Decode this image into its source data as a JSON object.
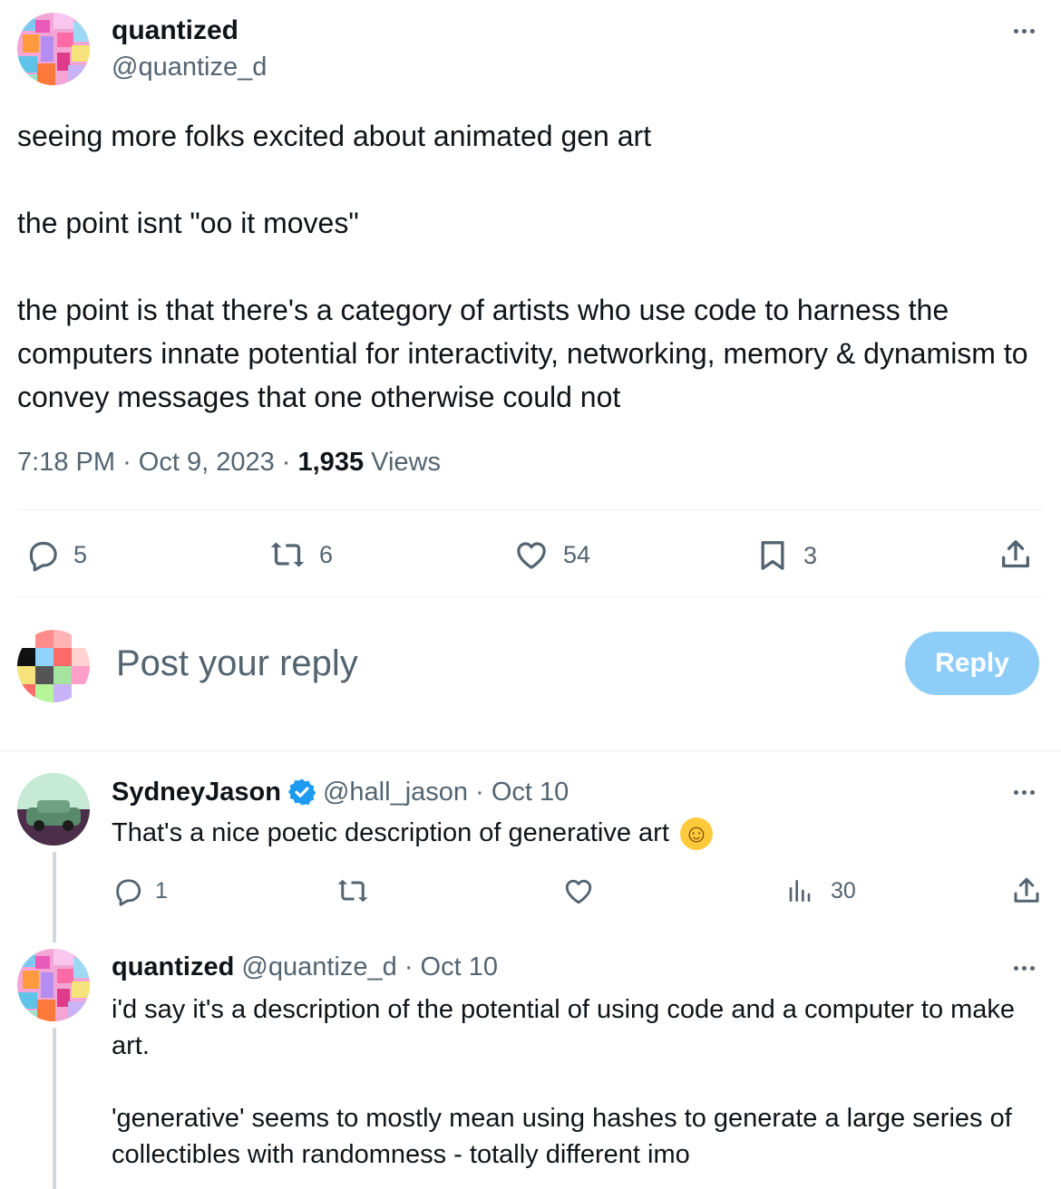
{
  "main_tweet": {
    "display_name": "quantized",
    "handle": "@quantize_d",
    "paragraphs": [
      "seeing more folks excited about animated gen art",
      "the point isnt \"oo it moves\"",
      "the point is that there's a category of artists who use code to harness the computers innate potential for interactivity, networking, memory & dynamism to convey messages that one otherwise could not"
    ],
    "time": "7:18 PM",
    "date": "Oct 9, 2023",
    "views_count": "1,935",
    "views_label": "Views",
    "replies": "5",
    "reposts": "6",
    "likes": "54",
    "bookmarks": "3"
  },
  "composer": {
    "placeholder": "Post your reply",
    "reply_label": "Reply"
  },
  "replies": [
    {
      "display_name": "SydneyJason",
      "handle": "@hall_jason",
      "date": "Oct 10",
      "text": "That's a nice poetic description of generative art",
      "emoji": "☺",
      "replies": "1",
      "views": "30"
    },
    {
      "display_name": "quantized",
      "handle": "@quantize_d",
      "date": "Oct 10",
      "paragraph1": "i'd say it's a description of the potential of using code and a computer to make art.",
      "paragraph2": "'generative' seems to mostly mean using hashes to generate a large series of collectibles with randomness - totally different imo"
    }
  ],
  "colors": {
    "accent": "#1d9bf0",
    "reply_button": "#8ecdf8",
    "muted_text": "#536471",
    "divider": "#eff3f4"
  },
  "icons": [
    "more-icon",
    "reply-icon",
    "repost-icon",
    "like-icon",
    "bookmark-icon",
    "share-icon",
    "views-icon",
    "verified-badge-icon"
  ]
}
